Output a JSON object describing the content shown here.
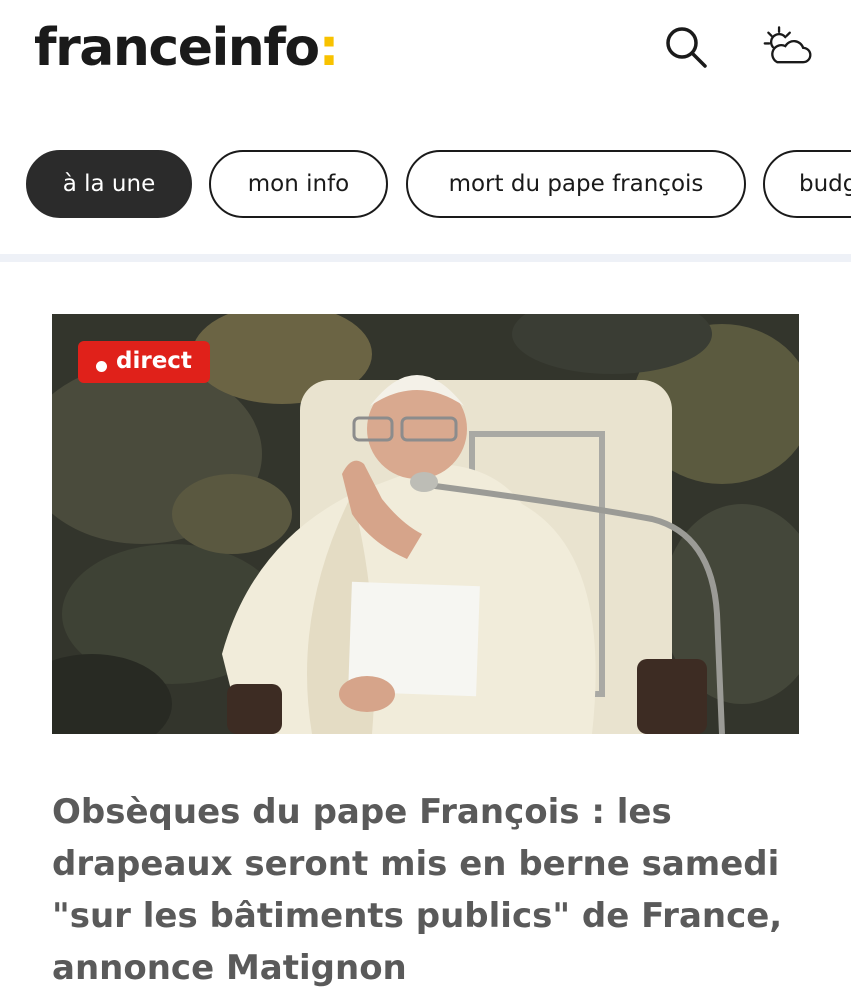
{
  "header": {
    "logo_text": "franceinfo",
    "logo_colon": ":",
    "logo_colon_color": "#f8c200",
    "search_icon": "search-icon",
    "weather_icon": "weather-sun-cloud-icon"
  },
  "tabs": [
    {
      "label": "à la une",
      "active": true
    },
    {
      "label": "mon info",
      "active": false
    },
    {
      "label": "mort du pape françois",
      "active": false
    },
    {
      "label": "budg",
      "active": false
    }
  ],
  "article": {
    "badge": "direct",
    "badge_color": "#e0211a",
    "image_description_icon": "photo",
    "headline": "Obsèques du pape François : les drapeaux seront mis en berne samedi \"sur les bâtiments publics\" de France, annonce Matignon"
  }
}
